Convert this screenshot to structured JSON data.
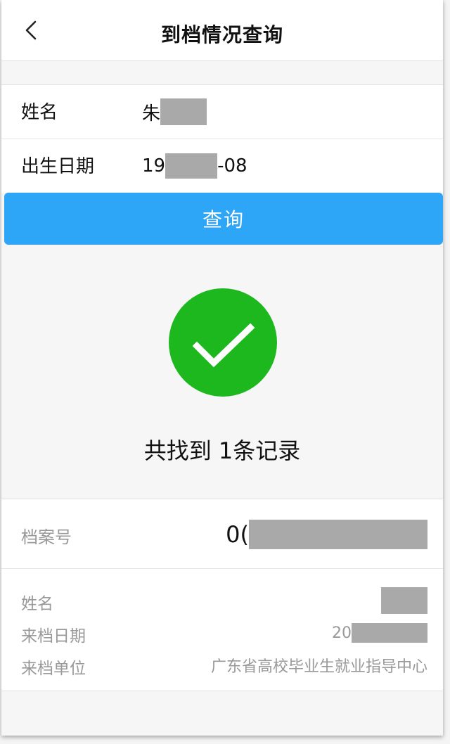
{
  "header": {
    "title": "到档情况查询",
    "back_icon": "chevron-left-icon"
  },
  "form": {
    "name_label": "姓名",
    "name_value": "朱",
    "birth_label": "出生日期",
    "birth_prefix": "19",
    "birth_suffix": "-08"
  },
  "query_button": {
    "label": "查询",
    "color": "#2ea6f7"
  },
  "result": {
    "icon": "success-check-icon",
    "icon_color": "#1db81d",
    "message": "共找到 1条记录"
  },
  "record": {
    "archive_label": "档案号",
    "archive_prefix": "0(",
    "name_label": "姓名",
    "date_label": "来档日期",
    "date_prefix": "20",
    "unit_label": "来档单位",
    "unit_value": "广东省高校毕业生就业指导中心"
  },
  "redaction_color": "#a9a9a9"
}
